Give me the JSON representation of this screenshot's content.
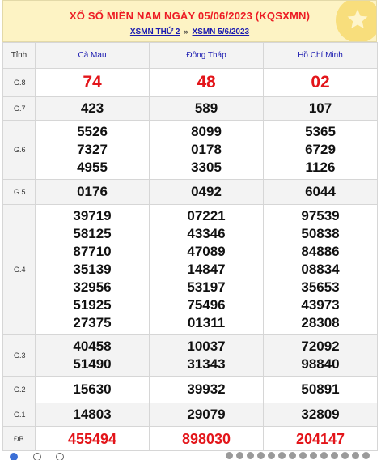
{
  "header": {
    "title": "XỔ SỐ MIỀN NAM NGÀY 05/06/2023 (KQSXMN)",
    "link1": "XSMN THỨ 2",
    "separator": "»",
    "link2": "XSMN 5/6/2023"
  },
  "table": {
    "col_tinh": "Tỉnh",
    "provinces": [
      "Cà Mau",
      "Đồng Tháp",
      "Hồ Chí Minh"
    ],
    "rows": [
      {
        "prize": "G.8",
        "values": [
          [
            "74"
          ],
          [
            "48"
          ],
          [
            "02"
          ]
        ]
      },
      {
        "prize": "G.7",
        "values": [
          [
            "423"
          ],
          [
            "589"
          ],
          [
            "107"
          ]
        ]
      },
      {
        "prize": "G.6",
        "values": [
          [
            "5526",
            "7327",
            "4955"
          ],
          [
            "8099",
            "0178",
            "3305"
          ],
          [
            "5365",
            "6729",
            "1126"
          ]
        ]
      },
      {
        "prize": "G.5",
        "values": [
          [
            "0176"
          ],
          [
            "0492"
          ],
          [
            "6044"
          ]
        ]
      },
      {
        "prize": "G.4",
        "values": [
          [
            "39719",
            "58125",
            "87710",
            "35139",
            "32956",
            "51925",
            "27375"
          ],
          [
            "07221",
            "43346",
            "47089",
            "14847",
            "53197",
            "75496",
            "01311"
          ],
          [
            "97539",
            "50838",
            "84886",
            "08834",
            "35653",
            "43973",
            "28308"
          ]
        ]
      },
      {
        "prize": "G.3",
        "values": [
          [
            "40458",
            "51490"
          ],
          [
            "10037",
            "31343"
          ],
          [
            "72092",
            "98840"
          ]
        ]
      },
      {
        "prize": "G.2",
        "values": [
          [
            "15630"
          ],
          [
            "39932"
          ],
          [
            "50891"
          ]
        ]
      },
      {
        "prize": "G.1",
        "values": [
          [
            "14803"
          ],
          [
            "29079"
          ],
          [
            "32809"
          ]
        ]
      },
      {
        "prize": "ĐB",
        "values": [
          [
            "455494"
          ],
          [
            "898030"
          ],
          [
            "204147"
          ]
        ]
      }
    ]
  },
  "colors": {
    "red": "#e3151a",
    "header_bg": "#fdf3c4",
    "link_blue": "#1a1ab0",
    "alt_row_bg": "#f3f3f3"
  },
  "icons": [
    "star-icon",
    "radio-icon",
    "ball-icon"
  ]
}
